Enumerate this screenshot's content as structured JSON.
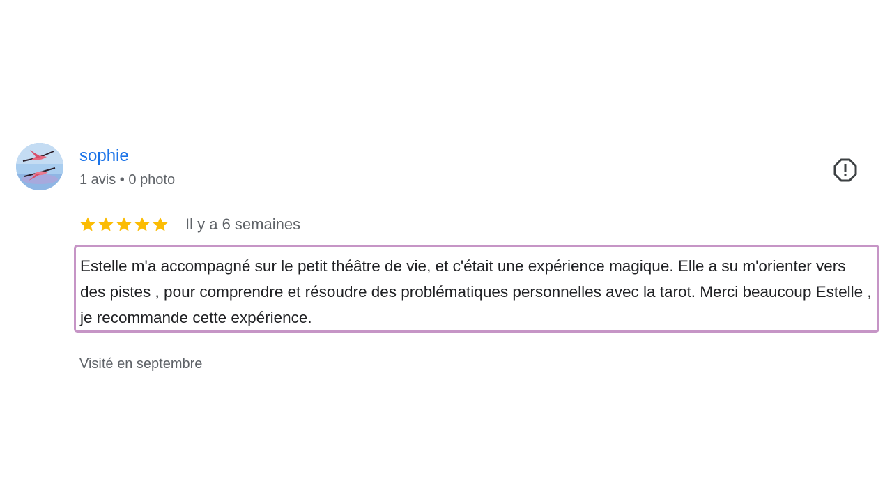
{
  "review": {
    "author": {
      "name": "sophie",
      "meta": "1 avis • 0 photo"
    },
    "rating": 5,
    "rating_max": 5,
    "date": "Il y a 6 semaines",
    "text": "Estelle m'a accompagné sur le petit théâtre de vie, et c'était une expérience magique. Elle a su m'orienter vers des pistes , pour comprendre et résoudre des problématiques personnelles avec la tarot. Merci beaucoup Estelle , je recommande cette expérience.",
    "visit": "Visité en septembre"
  },
  "icons": {
    "report": "report-icon",
    "star": "star-icon",
    "avatar": "flamingo-photo"
  },
  "colors": {
    "author_name": "#1a73e8",
    "secondary_text": "#5f6368",
    "body_text": "#202124",
    "star": "#fbbc04",
    "highlight_border": "#c695c6"
  }
}
